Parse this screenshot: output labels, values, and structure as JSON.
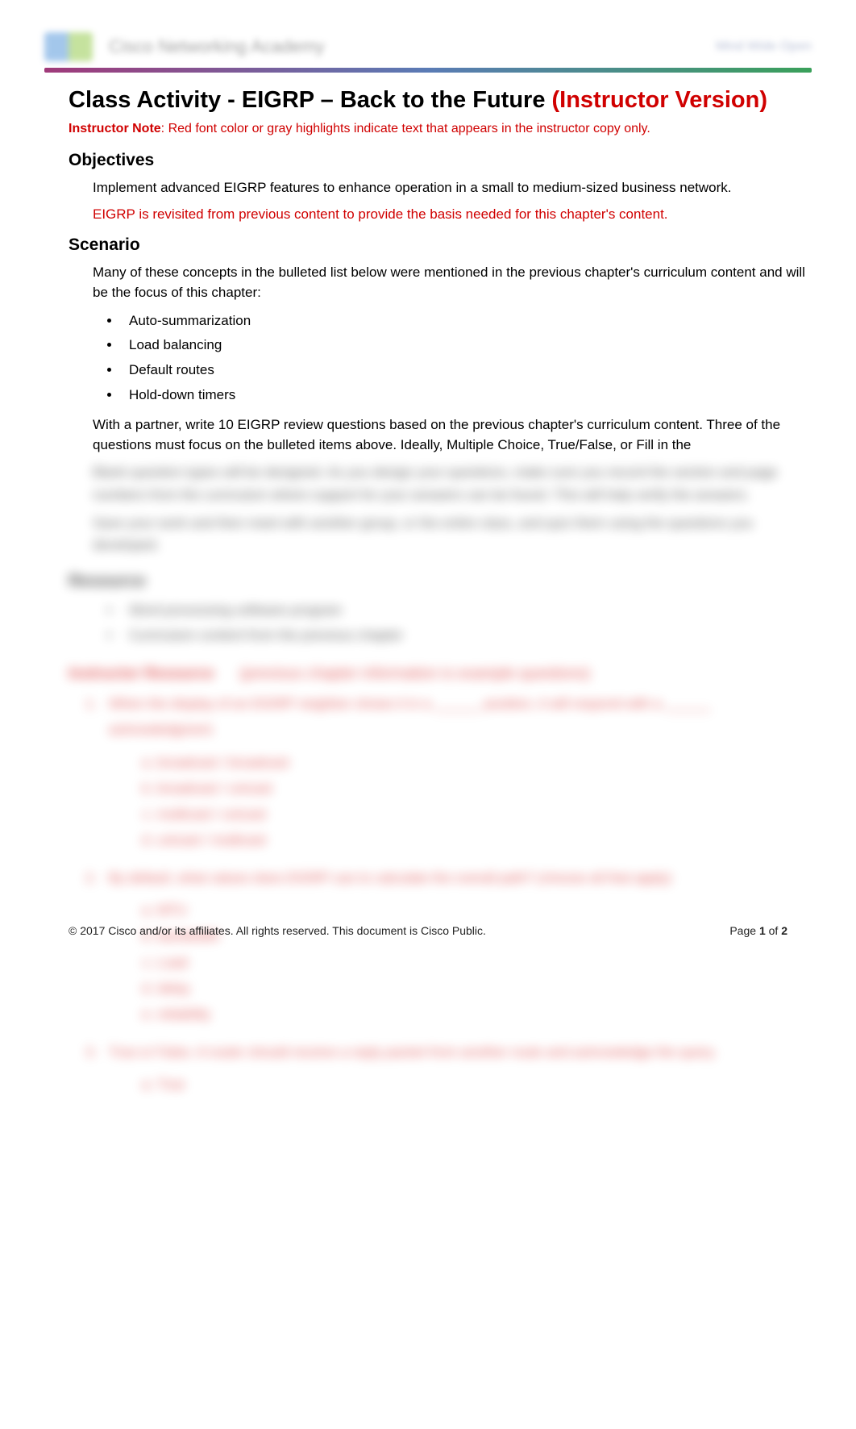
{
  "header": {
    "brand": "Cisco Networking Academy",
    "right_text": "Mind Wide Open"
  },
  "title_main": "Class Activity - EIGRP – Back to the Future ",
  "title_suffix": "(Instructor Version)",
  "instructor_note_label": "Instructor Note",
  "instructor_note_text": ": Red font color or gray highlights indicate text that appears in the instructor copy only.",
  "sections": {
    "objectives_heading": "Objectives",
    "objective_text": "Implement advanced EIGRP features to enhance operation in a small to medium-sized business network.",
    "objective_red": "EIGRP is revisited from previous content to provide the basis needed for this chapter's content.",
    "scenario_heading": "Scenario",
    "scenario_intro": "Many of these concepts in the bulleted list below were mentioned in the previous chapter's curriculum content and will be the focus of this chapter:",
    "bullets": [
      "Auto-summarization",
      "Load balancing",
      "Default routes",
      "Hold-down timers"
    ],
    "scenario_after": "With a partner, write 10 EIGRP review questions based on the previous chapter's curriculum content. Three of the questions must focus on the bulleted items above. Ideally, Multiple Choice, True/False, or Fill in the"
  },
  "blurred": {
    "para1": "Blank question types will be designed. As you design your questions, make sure you record the section and page numbers from the curriculum where support for your answers can be found. This will help verify the answers.",
    "para2": "Save your work and then meet with another group, or the entire class, and quiz them using the questions you developed.",
    "resource_heading": "Resource",
    "resource_items": [
      "Word processing software program",
      "Curriculum content from the previous chapter"
    ],
    "inst_heading_prefix": "Instructor Resource",
    "inst_heading_suffix": "(previous chapter information is example questions)",
    "q1": {
      "stem": "When the display of an EIGRP neighbor shows it in a ______ position, it will respond with a ______ acknowledgment.",
      "choices": [
        "broadcast / broadcast",
        "broadcast / unicast",
        "multicast / unicast",
        "unicast / multicast"
      ]
    },
    "q2": {
      "stem": "By default, what values does EIGRP use to calculate the overall path? (choose all that apply)",
      "choices": [
        "MTU",
        "bandwidth",
        "Load",
        "delay",
        "reliability"
      ]
    },
    "q3": {
      "stem": "True or False. A router should receive a reply packet from another route and acknowledge the query.",
      "choices": [
        "True"
      ]
    }
  },
  "footer": {
    "copyright": "© 2017 Cisco and/or its affiliates. All rights reserved. This document is Cisco Public.",
    "page_label": "Page ",
    "page_num": "1",
    "page_of": " of ",
    "page_total": "2"
  }
}
